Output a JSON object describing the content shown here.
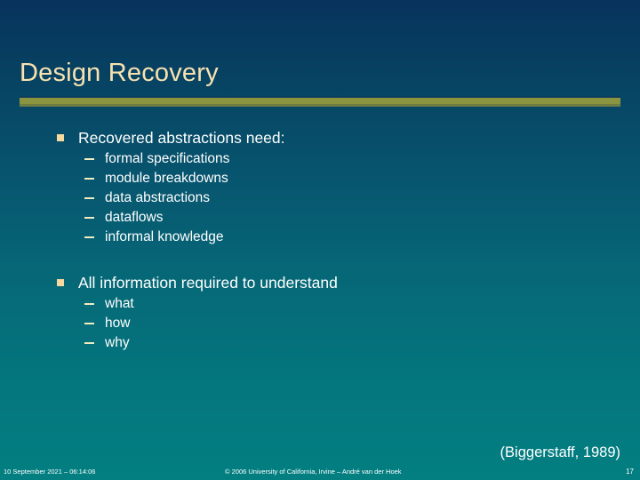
{
  "slide": {
    "title": "Design Recovery",
    "citation": "(Biggerstaff, 1989)",
    "bullets": [
      {
        "text": "Recovered abstractions need:",
        "sub": [
          "formal specifications",
          "module breakdowns",
          "data abstractions",
          "dataflows",
          "informal knowledge"
        ]
      },
      {
        "text": "All information required to understand",
        "sub": [
          "what",
          "how",
          "why"
        ]
      }
    ]
  },
  "footer": {
    "date": "10 September 2021 – 06:14:06",
    "copyright": "© 2006 University of California, Irvine – André van der Hoek",
    "slide_number": "17"
  },
  "colors": {
    "background_top": "#07335c",
    "background_bottom": "#037f81",
    "title_text": "#f7e2b0",
    "rule_main": "#8b9540",
    "rule_bottom": "#6f7c43",
    "bullet_square": "#f6d99f",
    "dash": "#f3ecc0",
    "body_text": "#ffffff"
  }
}
